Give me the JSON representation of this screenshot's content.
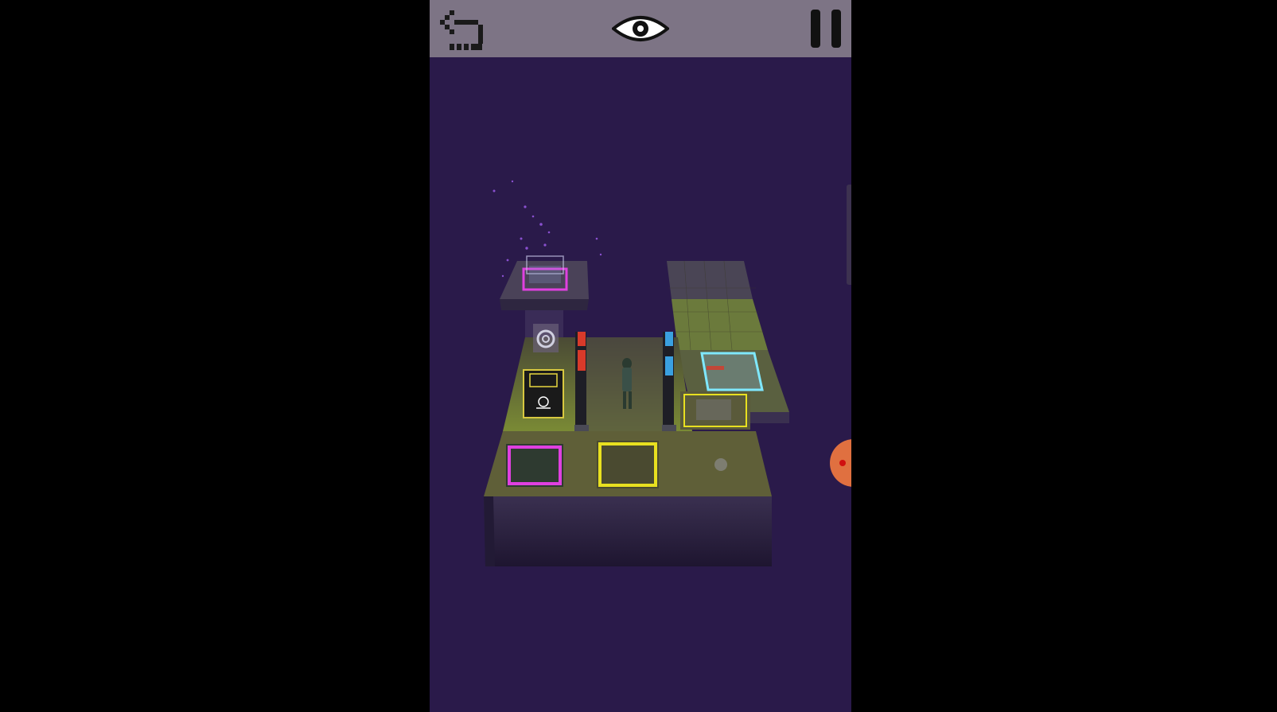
{
  "app": {
    "name": "",
    "background_color": "#2a1a4a",
    "top_bar_color": "#7d7485"
  },
  "top_bar": {
    "undo": {
      "icon": "undo-arrow-icon"
    },
    "view": {
      "icon": "eye-icon"
    },
    "pause": {
      "icon": "pause-icon"
    }
  },
  "scene": {
    "description_icons": [
      "spiral-leaf-symbol-icon",
      "hologram-cube-icon",
      "character-figure-icon"
    ],
    "colors": {
      "magenta_outline": "#e040e0",
      "yellow_outline": "#e8e020",
      "cyan_outline": "#7fe8ff",
      "red_pillar": "#d83a2a",
      "blue_pillar": "#3aa0e0",
      "grass": "#6b7a2c",
      "stone": "#3a3045"
    }
  },
  "side_controls": {
    "record": {
      "icon": "record-dot-icon",
      "color": "#e07040"
    }
  }
}
